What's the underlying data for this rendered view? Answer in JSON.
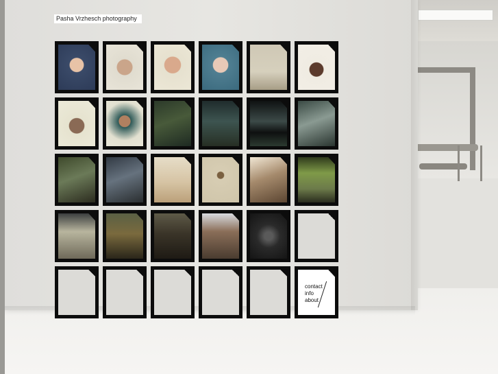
{
  "site": {
    "title": "Pasha Vrzhesch photography"
  },
  "nav": {
    "contact": "contact",
    "info": "info",
    "about": "about"
  },
  "colors": {
    "tile_border": "#0c0c0c",
    "wall": "#e3e2de"
  },
  "tiles": [
    {
      "bg": "radial-gradient(circle at 50% 45%, #e8c3a7 0 22%, #3a4a68 24%, #2d3b58 100%)"
    },
    {
      "bg": "radial-gradient(circle at 50% 50%, #caa58a 0 26%, #e0dccf 28%, #e8e4d8 100%)"
    },
    {
      "bg": "radial-gradient(circle at 50% 45%, #d9a98c 0 26%, #e6e1cf 28%, #ece7d6 100%)"
    },
    {
      "bg": "radial-gradient(circle at 50% 45%, #e7c9b7 0 24%, #4f7e91 26%, #3b6a7e 100%)"
    },
    {
      "bg": "linear-gradient(180deg, #cfc8b5 0%, #d6d0bd 60%, #a79d86 100%)"
    },
    {
      "bg": "radial-gradient(circle at 50% 55%, #5c3b2c 0 22%, #f0ece2 24%, #f2eee6 100%)"
    },
    {
      "bg": "radial-gradient(circle at 50% 55%, #8a6a55 0 24%, #e6e3cf 26%, #ecead9 100%)"
    },
    {
      "bg": "radial-gradient(circle at 50% 45%, #b08060 0 18%, #2f5a58 20%, #e2e0d0 62%, #e8e6d8 100%)"
    },
    {
      "bg": "linear-gradient(160deg, #2c3a2a 0%, #485a3a 45%, #1e2a22 100%)"
    },
    {
      "bg": "linear-gradient(180deg, #1f2c2c 0%, #3d5450 45%, #272f24 100%)"
    },
    {
      "bg": "linear-gradient(180deg, #0f1212 0%, #3c4a48 45%, #0e1010 70%, #2c3a30 100%)"
    },
    {
      "bg": "linear-gradient(160deg, #3a4a44 0%, #8a9a92 45%, #2a3530 100%)"
    },
    {
      "bg": "linear-gradient(160deg, #3f4a2c 0%, #6b7a58 45%, #2c2c1f 100%)"
    },
    {
      "bg": "linear-gradient(160deg, #323a44 0%, #66727e 45%, #2a2e30 100%)"
    },
    {
      "bg": "linear-gradient(180deg, #e6ddc8 0%, #d6c4a4 55%, #bba07a 100%)"
    },
    {
      "bg": "radial-gradient(circle at 50% 40%, #7a6040 0 10%, #d7cdb3 12%, #cfc5aa 100%)"
    },
    {
      "bg": "linear-gradient(160deg, #f1e7d4 0%, #a58a6c 45%, #5c4632 100%)"
    },
    {
      "bg": "linear-gradient(180deg, #2f3a1c 0%, #7f9a48 35%, #6c7a4a 70%, #2a2c1e 100%)"
    },
    {
      "bg": "linear-gradient(180deg, #3b3e3f 0%, #b8b59e 40%, #6f6a5a 100%)"
    },
    {
      "bg": "linear-gradient(180deg, #5a6044 0%, #7a6a3e 45%, #2a261a 100%)"
    },
    {
      "bg": "linear-gradient(180deg, #5e5a48 0%, #3a3428 45%, #1e1a14 100%)"
    },
    {
      "bg": "linear-gradient(180deg, #d8dbe0 0%, #8a6e58 40%, #4a3c30 100%)"
    },
    {
      "bg": "radial-gradient(circle at 50% 50%, #5a5a5a 0 14%, #2a2a2a 40%, #141414 100%)"
    },
    {
      "bg": "#dcdbd7",
      "empty": true
    },
    {
      "bg": "#dcdbd7",
      "empty": true
    },
    {
      "bg": "#dcdbd7",
      "empty": true
    },
    {
      "bg": "#dcdbd7",
      "empty": true
    },
    {
      "bg": "#dcdbd7",
      "empty": true
    },
    {
      "bg": "#dcdbd7",
      "empty": true
    },
    {
      "bg": "#ffffff",
      "contact": true
    }
  ]
}
